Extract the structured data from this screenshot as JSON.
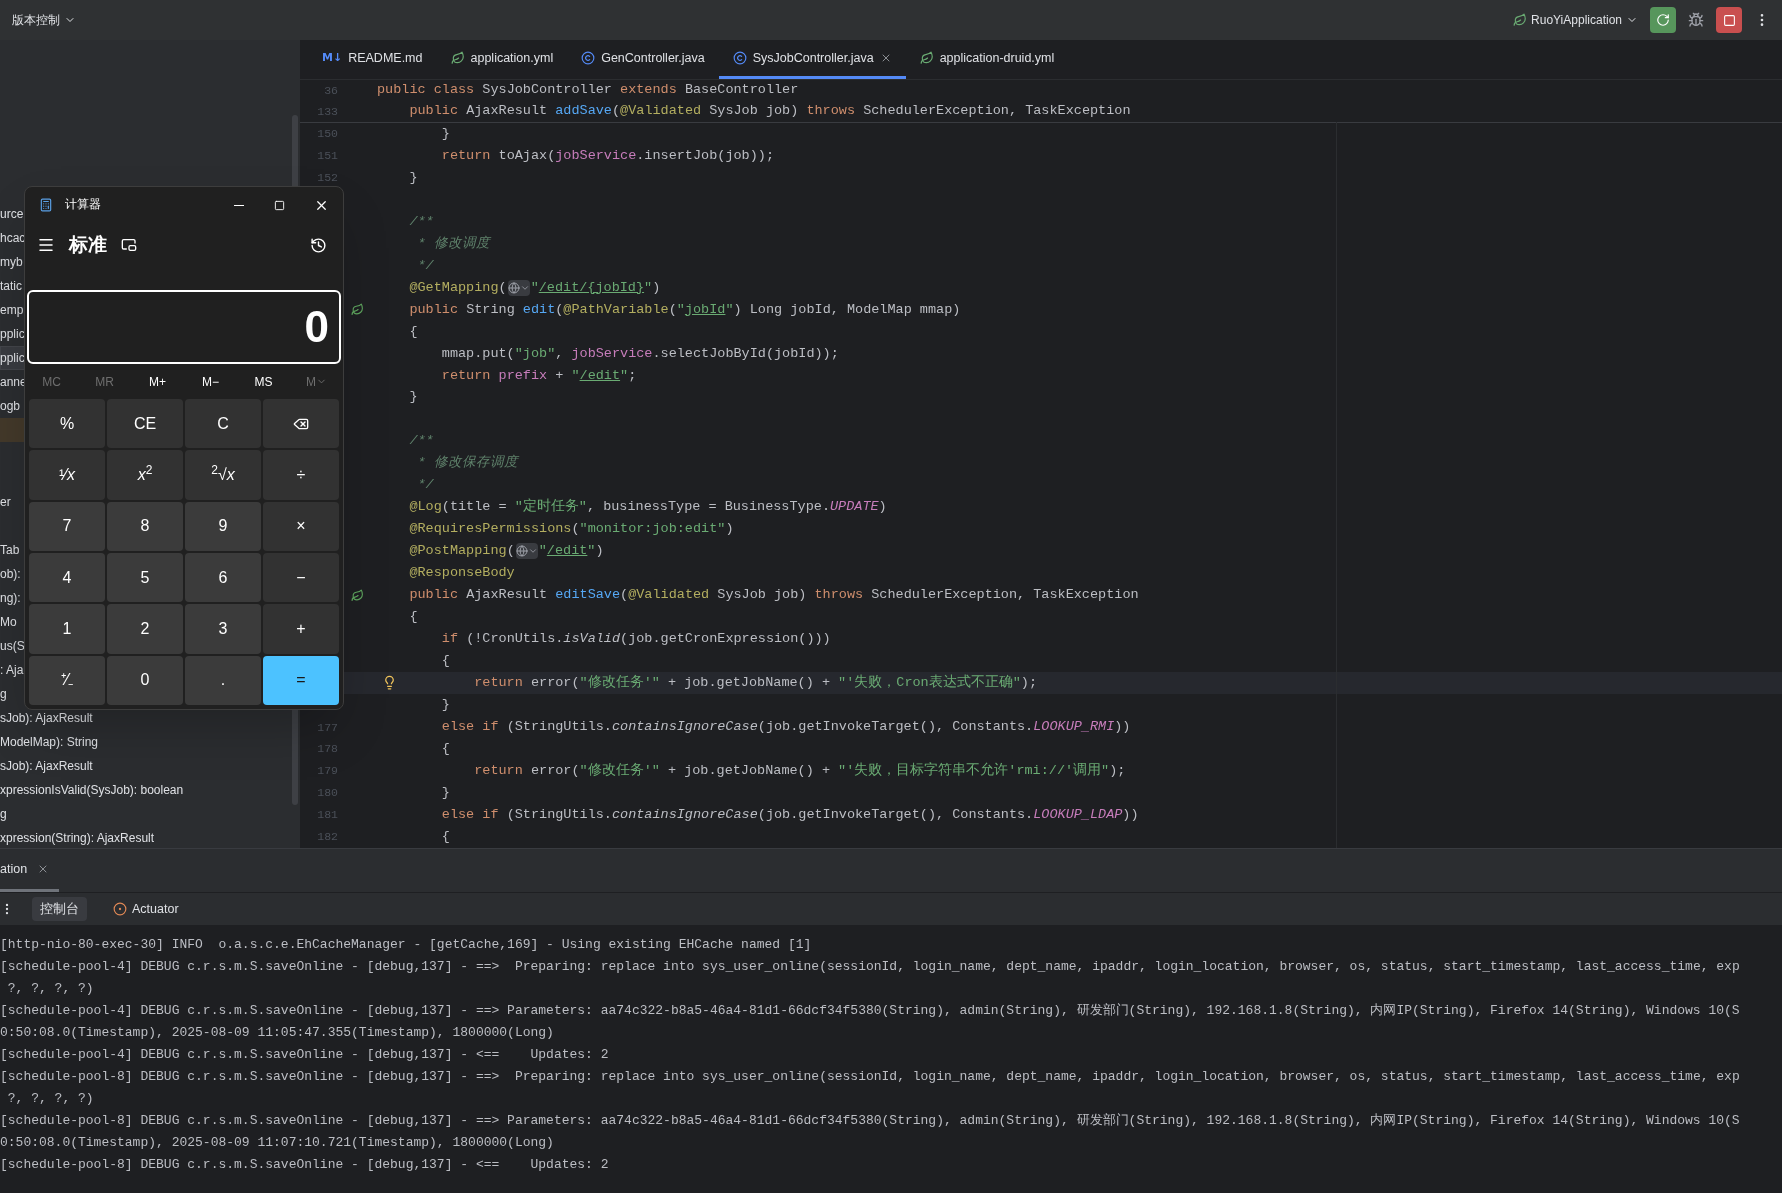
{
  "top_bar": {
    "vcs_label": "版本控制",
    "run_config": "RuoYiApplication"
  },
  "tabs": [
    {
      "badge": "M↓",
      "label": "README.md",
      "kind": "markdown",
      "selected": false
    },
    {
      "label": "application.yml",
      "kind": "config",
      "selected": false
    },
    {
      "label": "GenController.java",
      "kind": "class",
      "selected": false
    },
    {
      "label": "SysJobController.java",
      "kind": "class",
      "selected": true
    },
    {
      "label": "application-druid.yml",
      "kind": "config",
      "selected": false
    }
  ],
  "sidebar_rows": [
    {
      "text": "urce",
      "selected": false,
      "current": false
    },
    {
      "text": "hcac",
      "selected": false,
      "current": false
    },
    {
      "text": "myb",
      "selected": false,
      "current": false
    },
    {
      "text": "tatic",
      "selected": false,
      "current": false
    },
    {
      "text": "emp",
      "selected": false,
      "current": false
    },
    {
      "text": "pplic",
      "selected": false,
      "current": false
    },
    {
      "text": "pplic",
      "selected": true,
      "current": false
    },
    {
      "text": "anne",
      "selected": false,
      "current": false
    },
    {
      "text": "ogb",
      "selected": false,
      "current": false
    },
    {
      "selected": false,
      "current": true
    },
    {
      "selected": false,
      "current": false
    },
    {
      "selected": false,
      "current": false
    },
    {
      "text": "er",
      "selected": false,
      "current": false
    },
    {
      "selected": false,
      "current": false
    },
    {
      "text": "Tab",
      "selected": false,
      "current": false
    },
    {
      "text": "ob):",
      "selected": false,
      "current": false
    },
    {
      "text": "ng):",
      "selected": false,
      "current": false
    },
    {
      "text": "Mo",
      "selected": false,
      "current": false
    },
    {
      "text": "us(S",
      "selected": false,
      "current": false
    },
    {
      "text": ": Aja",
      "selected": false,
      "current": false
    },
    {
      "text": "g",
      "selected": false,
      "current": false
    },
    {
      "text": "sJob): AjaxResult",
      "selected": false,
      "current": false
    },
    {
      "text": "ModelMap): String",
      "selected": false,
      "current": false
    },
    {
      "text": "sJob): AjaxResult",
      "selected": false,
      "current": false
    },
    {
      "text": "xpressionIsValid(SysJob): boolean",
      "selected": false,
      "current": false
    },
    {
      "text": "g",
      "selected": false,
      "current": false
    },
    {
      "text": "xpression(String): AjaxResult",
      "selected": false,
      "current": false
    }
  ],
  "editor": {
    "sticky_lines": [
      {
        "number": "36",
        "tokens": [
          {
            "text": "public class ",
            "kind": "keyword"
          },
          {
            "text": "SysJobController ",
            "kind": "plain"
          },
          {
            "text": "extends ",
            "kind": "keyword"
          },
          {
            "text": "BaseController",
            "kind": "plain"
          }
        ]
      },
      {
        "number": "133",
        "tokens": [
          {
            "text": "    public ",
            "kind": "keyword"
          },
          {
            "text": "AjaxResult ",
            "kind": "plain"
          },
          {
            "text": "addSave",
            "kind": "declaration"
          },
          {
            "text": "(",
            "kind": "plain"
          },
          {
            "text": "@Validated ",
            "kind": "annotation"
          },
          {
            "text": "SysJob job) ",
            "kind": "plain"
          },
          {
            "text": "throws ",
            "kind": "keyword"
          },
          {
            "text": "SchedulerException, TaskException",
            "kind": "plain"
          }
        ]
      }
    ],
    "lines": [
      {
        "number": "150",
        "current": false,
        "tokens": [
          {
            "text": "        }",
            "kind": "plain"
          }
        ]
      },
      {
        "number": "151",
        "current": false,
        "tokens": [
          {
            "text": "        return ",
            "kind": "keyword"
          },
          {
            "text": "toAjax(",
            "kind": "plain"
          },
          {
            "text": "jobService",
            "kind": "field"
          },
          {
            "text": ".insertJob(job));",
            "kind": "plain"
          }
        ]
      },
      {
        "number": "152",
        "current": false,
        "tokens": [
          {
            "text": "    }",
            "kind": "plain"
          }
        ]
      },
      {
        "current": false
      },
      {
        "current": false,
        "tokens": [
          {
            "text": "    /**",
            "kind": "comment"
          }
        ]
      },
      {
        "current": false,
        "tokens": [
          {
            "text": "     * 修改调度",
            "kind": "comment"
          }
        ]
      },
      {
        "current": false,
        "tokens": [
          {
            "text": "     */",
            "kind": "comment"
          }
        ]
      },
      {
        "current": false,
        "tokens": [
          {
            "text": "    @GetMapping",
            "kind": "annotation"
          },
          {
            "text": "(",
            "kind": "plain"
          },
          {
            "kind": "globe"
          },
          {
            "text": "\"",
            "kind": "string"
          },
          {
            "text": "/edit/{jobId}",
            "kind": "link"
          },
          {
            "text": "\"",
            "kind": "string"
          },
          {
            "text": ")",
            "kind": "plain"
          }
        ]
      },
      {
        "current": false,
        "gutter": {
          "kind": "leaf"
        },
        "tokens": [
          {
            "text": "    public ",
            "kind": "keyword"
          },
          {
            "text": "String ",
            "kind": "plain"
          },
          {
            "text": "edit",
            "kind": "declaration"
          },
          {
            "text": "(",
            "kind": "plain"
          },
          {
            "text": "@PathVariable",
            "kind": "annotation"
          },
          {
            "text": "(",
            "kind": "plain"
          },
          {
            "text": "\"",
            "kind": "string"
          },
          {
            "text": "jobId",
            "kind": "link"
          },
          {
            "text": "\"",
            "kind": "string"
          },
          {
            "text": ") Long jobId, ModelMap mmap)",
            "kind": "plain"
          }
        ]
      },
      {
        "current": false,
        "tokens": [
          {
            "text": "    {",
            "kind": "plain"
          }
        ]
      },
      {
        "current": false,
        "tokens": [
          {
            "text": "        mmap.put(",
            "kind": "plain"
          },
          {
            "text": "\"job\"",
            "kind": "string"
          },
          {
            "text": ", ",
            "kind": "plain"
          },
          {
            "text": "jobService",
            "kind": "field"
          },
          {
            "text": ".selectJobById(jobId));",
            "kind": "plain"
          }
        ]
      },
      {
        "current": false,
        "tokens": [
          {
            "text": "        return ",
            "kind": "keyword"
          },
          {
            "text": "prefix",
            "kind": "field"
          },
          {
            "text": " + ",
            "kind": "plain"
          },
          {
            "text": "\"",
            "kind": "string"
          },
          {
            "text": "/edit",
            "kind": "link"
          },
          {
            "text": "\"",
            "kind": "string"
          },
          {
            "text": ";",
            "kind": "plain"
          }
        ]
      },
      {
        "current": false,
        "tokens": [
          {
            "text": "    }",
            "kind": "plain"
          }
        ]
      },
      {
        "current": false
      },
      {
        "current": false,
        "tokens": [
          {
            "text": "    /**",
            "kind": "comment"
          }
        ]
      },
      {
        "current": false,
        "tokens": [
          {
            "text": "     * 修改保存调度",
            "kind": "comment"
          }
        ]
      },
      {
        "current": false,
        "tokens": [
          {
            "text": "     */",
            "kind": "comment"
          }
        ]
      },
      {
        "current": false,
        "tokens": [
          {
            "text": "    @Log",
            "kind": "annotation"
          },
          {
            "text": "(title = ",
            "kind": "plain"
          },
          {
            "text": "\"定时任务\"",
            "kind": "string"
          },
          {
            "text": ", businessType = BusinessType.",
            "kind": "plain"
          },
          {
            "text": "UPDATE",
            "kind": "constant"
          },
          {
            "text": ")",
            "kind": "plain"
          }
        ]
      },
      {
        "current": false,
        "tokens": [
          {
            "text": "    @RequiresPermissions",
            "kind": "annotation"
          },
          {
            "text": "(",
            "kind": "plain"
          },
          {
            "text": "\"monitor:job:edit\"",
            "kind": "string"
          },
          {
            "text": ")",
            "kind": "plain"
          }
        ]
      },
      {
        "current": false,
        "tokens": [
          {
            "text": "    @PostMapping",
            "kind": "annotation"
          },
          {
            "text": "(",
            "kind": "plain"
          },
          {
            "kind": "globe"
          },
          {
            "text": "\"",
            "kind": "string"
          },
          {
            "text": "/edit",
            "kind": "link"
          },
          {
            "text": "\"",
            "kind": "string"
          },
          {
            "text": ")",
            "kind": "plain"
          }
        ]
      },
      {
        "current": false,
        "tokens": [
          {
            "text": "    @ResponseBody",
            "kind": "annotation"
          }
        ]
      },
      {
        "current": false,
        "gutter": {
          "kind": "leaf"
        },
        "tokens": [
          {
            "text": "    public ",
            "kind": "keyword"
          },
          {
            "text": "AjaxResult ",
            "kind": "plain"
          },
          {
            "text": "editSave",
            "kind": "declaration"
          },
          {
            "text": "(",
            "kind": "plain"
          },
          {
            "text": "@Validated ",
            "kind": "annotation"
          },
          {
            "text": "SysJob job) ",
            "kind": "plain"
          },
          {
            "text": "throws ",
            "kind": "keyword"
          },
          {
            "text": "SchedulerException, TaskException",
            "kind": "plain"
          }
        ]
      },
      {
        "current": false,
        "tokens": [
          {
            "text": "    {",
            "kind": "plain"
          }
        ]
      },
      {
        "current": false,
        "tokens": [
          {
            "text": "        if ",
            "kind": "keyword"
          },
          {
            "text": "(!CronUtils.",
            "kind": "plain"
          },
          {
            "text": "isValid",
            "kind": "static"
          },
          {
            "text": "(job.getCronExpression()))",
            "kind": "plain"
          }
        ]
      },
      {
        "current": false,
        "tokens": [
          {
            "text": "        {",
            "kind": "plain"
          }
        ]
      },
      {
        "current": true,
        "hint": {
          "kind": "bulb"
        },
        "tokens": [
          {
            "text": "            return ",
            "kind": "keyword"
          },
          {
            "text": "error(",
            "kind": "plain"
          },
          {
            "text": "\"修改任务'\"",
            "kind": "string"
          },
          {
            "text": " + job.getJobName() + ",
            "kind": "plain"
          },
          {
            "text": "\"'失败，Cron表达式不正确\"",
            "kind": "string"
          },
          {
            "text": ");",
            "kind": "plain"
          }
        ]
      },
      {
        "current": false,
        "tokens": [
          {
            "text": "        }",
            "kind": "plain"
          }
        ]
      },
      {
        "number": "177",
        "current": false,
        "tokens": [
          {
            "text": "        else if ",
            "kind": "keyword"
          },
          {
            "text": "(StringUtils.",
            "kind": "plain"
          },
          {
            "text": "containsIgnoreCase",
            "kind": "static"
          },
          {
            "text": "(job.getInvokeTarget(), Constants.",
            "kind": "plain"
          },
          {
            "text": "LOOKUP_RMI",
            "kind": "constant"
          },
          {
            "text": "))",
            "kind": "plain"
          }
        ]
      },
      {
        "number": "178",
        "current": false,
        "tokens": [
          {
            "text": "        {",
            "kind": "plain"
          }
        ]
      },
      {
        "number": "179",
        "current": false,
        "tokens": [
          {
            "text": "            return ",
            "kind": "keyword"
          },
          {
            "text": "error(",
            "kind": "plain"
          },
          {
            "text": "\"修改任务'\"",
            "kind": "string"
          },
          {
            "text": " + job.getJobName() + ",
            "kind": "plain"
          },
          {
            "text": "\"'失败，目标字符串不允许'rmi://'调用\"",
            "kind": "string"
          },
          {
            "text": ");",
            "kind": "plain"
          }
        ]
      },
      {
        "number": "180",
        "current": false,
        "tokens": [
          {
            "text": "        }",
            "kind": "plain"
          }
        ]
      },
      {
        "number": "181",
        "current": false,
        "tokens": [
          {
            "text": "        else if ",
            "kind": "keyword"
          },
          {
            "text": "(StringUtils.",
            "kind": "plain"
          },
          {
            "text": "containsIgnoreCase",
            "kind": "static"
          },
          {
            "text": "(job.getInvokeTarget(), Constants.",
            "kind": "plain"
          },
          {
            "text": "LOOKUP_LDAP",
            "kind": "constant"
          },
          {
            "text": "))",
            "kind": "plain"
          }
        ]
      },
      {
        "number": "182",
        "current": false,
        "tokens": [
          {
            "text": "        {",
            "kind": "plain"
          }
        ]
      }
    ]
  },
  "calculator": {
    "title": "计算器",
    "mode": "标准",
    "display": "0",
    "memory": [
      {
        "label": "MC",
        "disabled": true
      },
      {
        "label": "MR",
        "disabled": true
      },
      {
        "label": "M+",
        "disabled": false
      },
      {
        "label": "M−",
        "disabled": false
      },
      {
        "label": "MS",
        "disabled": false
      },
      {
        "label": "M",
        "disabled": true,
        "kind": "menu"
      }
    ],
    "keys": [
      {
        "label": "%",
        "kind": "function"
      },
      {
        "label": "CE",
        "kind": "function"
      },
      {
        "label": "C",
        "kind": "function"
      },
      {
        "kind": "backspace"
      },
      {
        "label": "¹⁄*x*",
        "kind": "function"
      },
      {
        "label": "*x*$^{2}$",
        "kind": "function"
      },
      {
        "label": "$^{2}$√*x*",
        "kind": "function"
      },
      {
        "label": "÷",
        "kind": "function"
      },
      {
        "label": "7",
        "kind": "digit"
      },
      {
        "label": "8",
        "kind": "digit"
      },
      {
        "label": "9",
        "kind": "digit"
      },
      {
        "label": "×",
        "kind": "function"
      },
      {
        "label": "4",
        "kind": "digit"
      },
      {
        "label": "5",
        "kind": "digit"
      },
      {
        "label": "6",
        "kind": "digit"
      },
      {
        "label": "−",
        "kind": "function"
      },
      {
        "label": "1",
        "kind": "digit"
      },
      {
        "label": "2",
        "kind": "digit"
      },
      {
        "label": "3",
        "kind": "digit"
      },
      {
        "label": "+",
        "kind": "function"
      },
      {
        "label": "⁺⁄₋",
        "kind": "digit"
      },
      {
        "label": "0",
        "kind": "digit"
      },
      {
        "label": ".",
        "kind": "digit"
      },
      {
        "label": "=",
        "kind": "equals"
      }
    ]
  },
  "run_panel": {
    "tabs": [
      {
        "label": "ation",
        "selected": true
      }
    ],
    "tool_tabs": [
      {
        "label": "控制台",
        "kind": "plain",
        "selected": true
      },
      {
        "label": "Actuator",
        "kind": "actuator",
        "selected": false
      }
    ],
    "console_lines": [
      "[http-nio-80-exec-30] INFO  o.a.s.c.e.EhCacheManager - [getCache,169] - Using existing EHCache named [1]",
      "[schedule-pool-4] DEBUG c.r.s.m.S.saveOnline - [debug,137] - ==>  Preparing: replace into sys_user_online(sessionId, login_name, dept_name, ipaddr, login_location, browser, os, status, start_timestamp, last_access_time, exp",
      " ?, ?, ?, ?)",
      "[schedule-pool-4] DEBUG c.r.s.m.S.saveOnline - [debug,137] - ==> Parameters: aa74c322-b8a5-46a4-81d1-66dcf34f5380(String), admin(String), 研发部门(String), 192.168.1.8(String), 内网IP(String), Firefox 14(String), Windows 10(S",
      "0:50:08.0(Timestamp), 2025-08-09 11:05:47.355(Timestamp), 1800000(Long)",
      "[schedule-pool-4] DEBUG c.r.s.m.S.saveOnline - [debug,137] - <==    Updates: 2",
      "[schedule-pool-8] DEBUG c.r.s.m.S.saveOnline - [debug,137] - ==>  Preparing: replace into sys_user_online(sessionId, login_name, dept_name, ipaddr, login_location, browser, os, status, start_timestamp, last_access_time, exp",
      " ?, ?, ?, ?)",
      "[schedule-pool-8] DEBUG c.r.s.m.S.saveOnline - [debug,137] - ==> Parameters: aa74c322-b8a5-46a4-81d1-66dcf34f5380(String), admin(String), 研发部门(String), 192.168.1.8(String), 内网IP(String), Firefox 14(String), Windows 10(S",
      "0:50:08.0(Timestamp), 2025-08-09 11:07:10.721(Timestamp), 1800000(Long)",
      "[schedule-pool-8] DEBUG c.r.s.m.S.saveOnline - [debug,137] - <==    Updates: 2"
    ]
  }
}
